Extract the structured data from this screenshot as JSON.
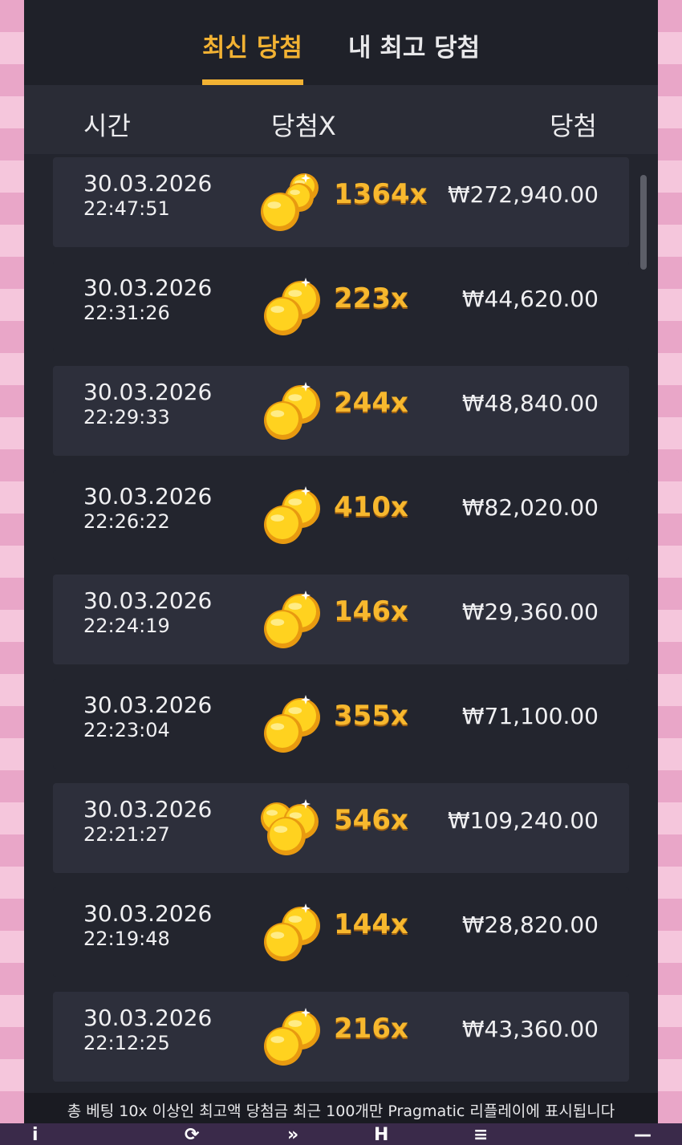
{
  "tabs": [
    {
      "label": "최신 당첨",
      "active": true
    },
    {
      "label": "내 최고 당첨",
      "active": false
    }
  ],
  "columns": {
    "time": "시간",
    "multiplier": "당첨X",
    "win": "당첨"
  },
  "rows": [
    {
      "date": "30.03.2026",
      "time": "22:47:51",
      "multiplier": "1364x",
      "amount": "₩272,940.00",
      "icon": "coin-stack-icon"
    },
    {
      "date": "30.03.2026",
      "time": "22:31:26",
      "multiplier": "223x",
      "amount": "₩44,620.00",
      "icon": "two-coins-icon"
    },
    {
      "date": "30.03.2026",
      "time": "22:29:33",
      "multiplier": "244x",
      "amount": "₩48,840.00",
      "icon": "two-coins-icon"
    },
    {
      "date": "30.03.2026",
      "time": "22:26:22",
      "multiplier": "410x",
      "amount": "₩82,020.00",
      "icon": "two-coins-icon"
    },
    {
      "date": "30.03.2026",
      "time": "22:24:19",
      "multiplier": "146x",
      "amount": "₩29,360.00",
      "icon": "two-coins-icon"
    },
    {
      "date": "30.03.2026",
      "time": "22:23:04",
      "multiplier": "355x",
      "amount": "₩71,100.00",
      "icon": "two-coins-icon"
    },
    {
      "date": "30.03.2026",
      "time": "22:21:27",
      "multiplier": "546x",
      "amount": "₩109,240.00",
      "icon": "three-coins-icon"
    },
    {
      "date": "30.03.2026",
      "time": "22:19:48",
      "multiplier": "144x",
      "amount": "₩28,820.00",
      "icon": "two-coins-icon"
    },
    {
      "date": "30.03.2026",
      "time": "22:12:25",
      "multiplier": "216x",
      "amount": "₩43,360.00",
      "icon": "two-coins-icon"
    }
  ],
  "footer": {
    "note": "총 베팅 10x 이상인 최고액 당첨금 최근 100개만 Pragmatic 리플레이에 표시됩니다"
  },
  "colors": {
    "accent": "#f2b233",
    "modal_bg": "#23252e",
    "row_alt": "#2d2f3b"
  }
}
